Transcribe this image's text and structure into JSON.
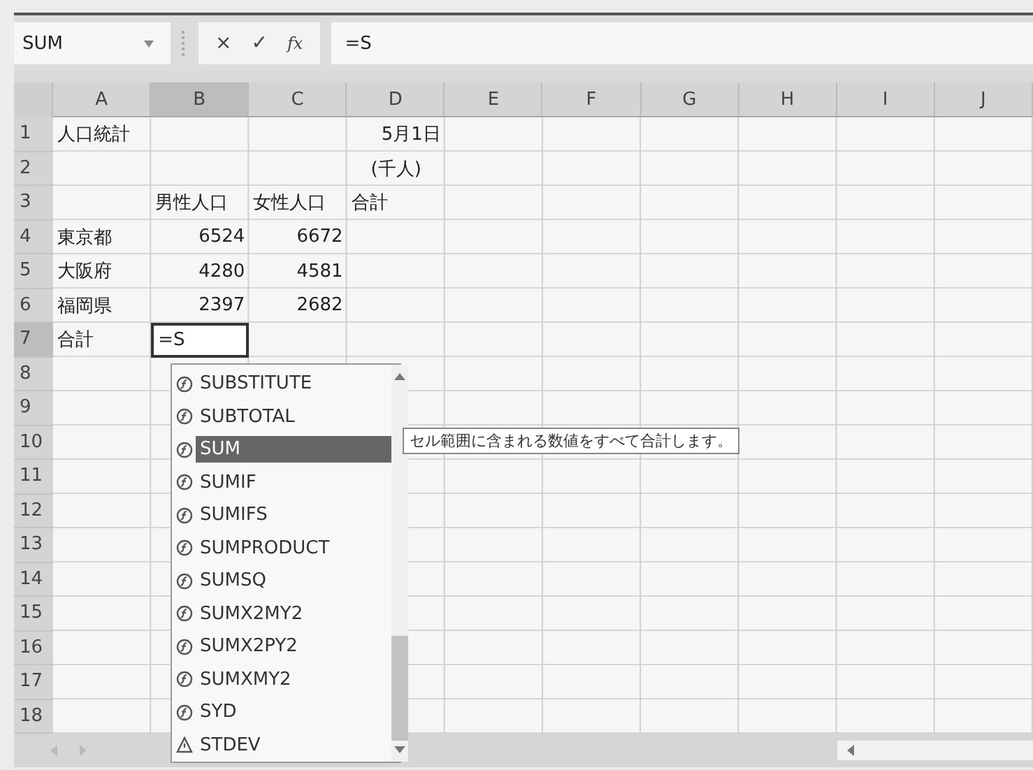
{
  "formula_bar": {
    "name_box": "SUM",
    "cancel": "×",
    "enter": "✓",
    "function": "fx",
    "formula": "=S"
  },
  "columns": [
    {
      "label": "A",
      "selected": false
    },
    {
      "label": "B",
      "selected": true
    },
    {
      "label": "C",
      "selected": false
    },
    {
      "label": "D",
      "selected": false
    },
    {
      "label": "E",
      "selected": false
    },
    {
      "label": "F",
      "selected": false
    },
    {
      "label": "G",
      "selected": false
    },
    {
      "label": "H",
      "selected": false
    },
    {
      "label": "I",
      "selected": false
    },
    {
      "label": "J",
      "selected": false
    }
  ],
  "rows": [
    {
      "number": "1",
      "selected": false,
      "cells": [
        {
          "text": "人口統計",
          "kind": "text",
          "active": false
        },
        null,
        null,
        {
          "text": "5月1日",
          "kind": "date",
          "active": false
        }
      ]
    },
    {
      "number": "2",
      "selected": false,
      "cells": [
        null,
        null,
        null,
        {
          "text": "(千人)",
          "kind": "unit",
          "active": false
        }
      ]
    },
    {
      "number": "3",
      "selected": false,
      "cells": [
        null,
        {
          "text": "男性人口",
          "kind": "text",
          "active": false
        },
        {
          "text": "女性人口",
          "kind": "text",
          "active": false
        },
        {
          "text": "合計",
          "kind": "text",
          "active": false
        }
      ]
    },
    {
      "number": "4",
      "selected": false,
      "cells": [
        {
          "text": "東京都",
          "kind": "text",
          "active": false
        },
        {
          "text": "6524",
          "kind": "number",
          "active": false
        },
        {
          "text": "6672",
          "kind": "number",
          "active": false
        }
      ]
    },
    {
      "number": "5",
      "selected": false,
      "cells": [
        {
          "text": "大阪府",
          "kind": "text",
          "active": false
        },
        {
          "text": "4280",
          "kind": "number",
          "active": false
        },
        {
          "text": "4581",
          "kind": "number",
          "active": false
        }
      ]
    },
    {
      "number": "6",
      "selected": false,
      "cells": [
        {
          "text": "福岡県",
          "kind": "text",
          "active": false
        },
        {
          "text": "2397",
          "kind": "number",
          "active": false
        },
        {
          "text": "2682",
          "kind": "number",
          "active": false
        }
      ]
    },
    {
      "number": "7",
      "selected": true,
      "cells": [
        {
          "text": "合計",
          "kind": "text",
          "active": false
        },
        {
          "text": "=S",
          "kind": "text",
          "active": true
        }
      ]
    },
    {
      "number": "8",
      "selected": false,
      "cells": []
    },
    {
      "number": "9",
      "selected": false,
      "cells": []
    },
    {
      "number": "10",
      "selected": false,
      "cells": []
    },
    {
      "number": "11",
      "selected": false,
      "cells": []
    },
    {
      "number": "12",
      "selected": false,
      "cells": []
    },
    {
      "number": "13",
      "selected": false,
      "cells": []
    },
    {
      "number": "14",
      "selected": false,
      "cells": []
    },
    {
      "number": "15",
      "selected": false,
      "cells": []
    },
    {
      "number": "16",
      "selected": false,
      "cells": []
    },
    {
      "number": "17",
      "selected": false,
      "cells": []
    },
    {
      "number": "18",
      "selected": false,
      "cells": []
    }
  ],
  "autocomplete": {
    "items": [
      {
        "name": "SUBSTITUTE",
        "kind": "function",
        "selected": false
      },
      {
        "name": "SUBTOTAL",
        "kind": "function",
        "selected": false
      },
      {
        "name": "SUM",
        "kind": "function",
        "selected": true
      },
      {
        "name": "SUMIF",
        "kind": "function",
        "selected": false
      },
      {
        "name": "SUMIFS",
        "kind": "function",
        "selected": false
      },
      {
        "name": "SUMPRODUCT",
        "kind": "function",
        "selected": false
      },
      {
        "name": "SUMSQ",
        "kind": "function",
        "selected": false
      },
      {
        "name": "SUMX2MY2",
        "kind": "function",
        "selected": false
      },
      {
        "name": "SUMX2PY2",
        "kind": "function",
        "selected": false
      },
      {
        "name": "SUMXMY2",
        "kind": "function",
        "selected": false
      },
      {
        "name": "SYD",
        "kind": "function",
        "selected": false
      },
      {
        "name": "STDEV",
        "kind": "compatibility",
        "selected": false
      }
    ],
    "tooltip": "セル範囲に含まれる数値をすべて合計します。"
  }
}
